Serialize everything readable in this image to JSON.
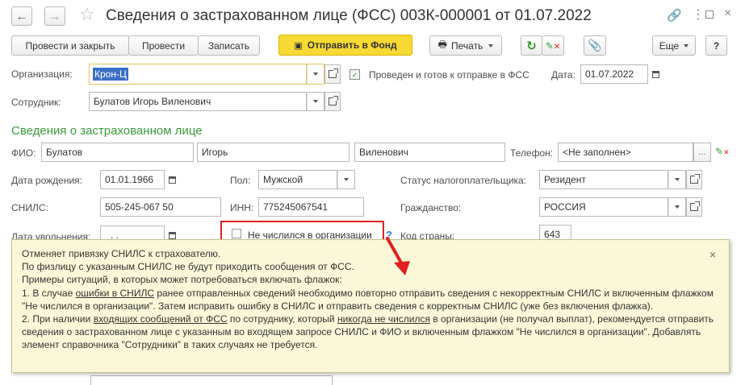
{
  "window": {
    "title": "Сведения о застрахованном лице (ФСС) 003К-000001 от 01.07.2022"
  },
  "toolbar": {
    "post_close": "Провести и закрыть",
    "post": "Провести",
    "save": "Записать",
    "send": "Отправить в Фонд",
    "print": "Печать",
    "more": "Еще",
    "help": "?"
  },
  "header": {
    "org_label": "Организация:",
    "org_value": "Крон-Ц",
    "status_text": "Проведен и готов к отправке в ФСС",
    "date_label": "Дата:",
    "date_value": "01.07.2022",
    "employee_label": "Сотрудник:",
    "employee_value": "Булатов Игорь Виленович"
  },
  "section": {
    "title": "Сведения о застрахованном лице",
    "fio_label": "ФИО:",
    "last_name": "Булатов",
    "first_name": "Игорь",
    "middle_name": "Виленович",
    "phone_label": "Телефон:",
    "phone_value": "<Не заполнен>",
    "birth_label": "Дата рождения:",
    "birth_value": "01.01.1966",
    "gender_label": "Пол:",
    "gender_value": "Мужской",
    "taxstatus_label": "Статус налогоплательщика:",
    "taxstatus_value": "Резидент",
    "snils_label": "СНИЛС:",
    "snils_value": "505-245-067 50",
    "inn_label": "ИНН:",
    "inn_value": "775245067541",
    "citizenship_label": "Гражданство:",
    "citizenship_value": "РОССИЯ",
    "dismissal_label": "Дата увольнения:",
    "dismissal_value": ". .",
    "not_listed_label": "Не числился в организации",
    "help_mark": "?",
    "country_code_label": "Код страны:",
    "country_code_value": "643"
  },
  "tooltip": {
    "line1": "Отменяет привязку СНИЛС к страхователю.",
    "line2": "По физлицу с указанным СНИЛС не будут приходить сообщения от ФСС.",
    "line3": "Примеры ситуаций, в которых может потребоваться включать флажок:",
    "p1_a": "1. В случае ",
    "p1_link": "ошибки в СНИЛС",
    "p1_b": " ранее отправленных сведений необходимо повторно отправить сведения с некорректным СНИЛС и включенным флажком \"Не числился в организации\". Затем исправить ошибку в СНИЛС и отправить сведения с корректным СНИЛС (уже без включения флажка).",
    "p2_a": "2. При наличии ",
    "p2_link": "входящих сообщений от ФСС",
    "p2_b": " по сотруднику, который ",
    "p2_link2": "никогда не числился",
    "p2_c": " в организации (не получал выплат), рекомендуется отправить сведения о застрахованном лице с указанным во входящем запросе СНИЛС и ФИО и включенным флажком \"Не числился в организации\". Добавлять элемент справочника \"Сотрудники\" в таких случаях не требуется.",
    "close": "×"
  },
  "colors": {
    "accent_green": "#3a9a3a",
    "send_button": "#f7d933",
    "highlight_red": "#e02020",
    "tooltip_bg": "#fbf8d9"
  }
}
